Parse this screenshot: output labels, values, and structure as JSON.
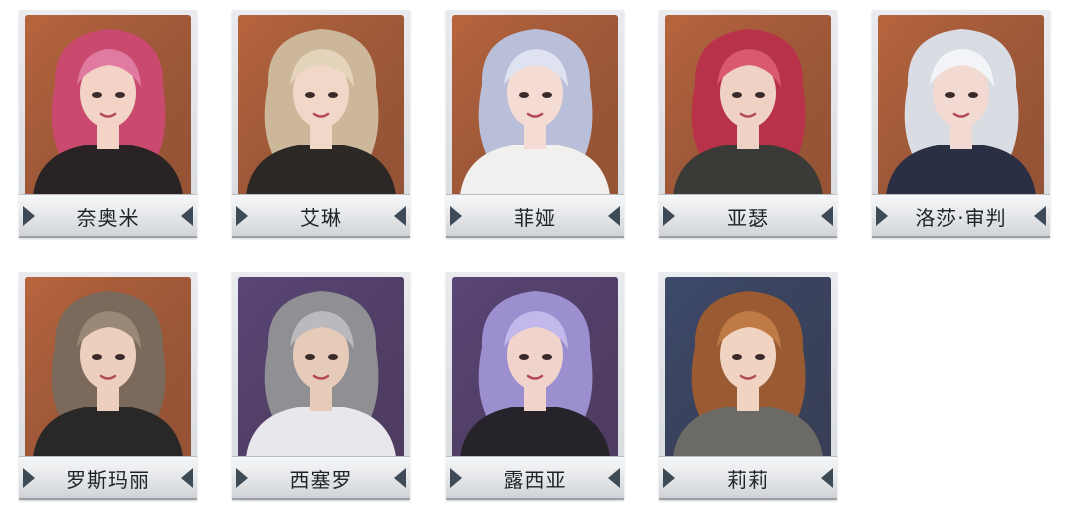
{
  "roster": {
    "characters": [
      {
        "name": "奈奥米",
        "bg": "#b8653e",
        "hair": "#c94a6e",
        "hair2": "#e07aa0",
        "skin": "#f2d3c6",
        "outfit": "#2a2326"
      },
      {
        "name": "艾琳",
        "bg": "#b8653e",
        "hair": "#cdb79a",
        "hair2": "#e3d4bb",
        "skin": "#f0d7c7",
        "outfit": "#2b2826"
      },
      {
        "name": "菲娅",
        "bg": "#b8653e",
        "hair": "#b9bfd9",
        "hair2": "#dfe2f0",
        "skin": "#f4dcd4",
        "outfit": "#f2f0ee"
      },
      {
        "name": "亚瑟",
        "bg": "#b8653e",
        "hair": "#b8324a",
        "hair2": "#d85a6c",
        "skin": "#f0d2c4",
        "outfit": "#3a3a36"
      },
      {
        "name": "洛莎·审判",
        "bg": "#b8653e",
        "hair": "#d9dce3",
        "hair2": "#f3f4f7",
        "skin": "#f2dad2",
        "outfit": "#2b2f44"
      },
      {
        "name": "罗斯玛丽",
        "bg": "#b8653e",
        "hair": "#7b6a5c",
        "hair2": "#9a8877",
        "skin": "#ecd0bd",
        "outfit": "#2a2827"
      },
      {
        "name": "西塞罗",
        "bg": "#5a4678",
        "hair": "#8f8f94",
        "hair2": "#b9b9be",
        "skin": "#e7cbb9",
        "outfit": "#e8e8ec"
      },
      {
        "name": "露西亚",
        "bg": "#5a4678",
        "hair": "#9b8fd0",
        "hair2": "#c2b8ea",
        "skin": "#f0d3cb",
        "outfit": "#26232b"
      },
      {
        "name": "莉莉",
        "bg": "#3d4a6b",
        "hair": "#9a5a32",
        "hair2": "#c07a45",
        "skin": "#f0d3c0",
        "outfit": "#6c6a66"
      }
    ]
  },
  "colors": {
    "chevron": "#3e4a55",
    "nameplate_text": "#1f2328"
  }
}
